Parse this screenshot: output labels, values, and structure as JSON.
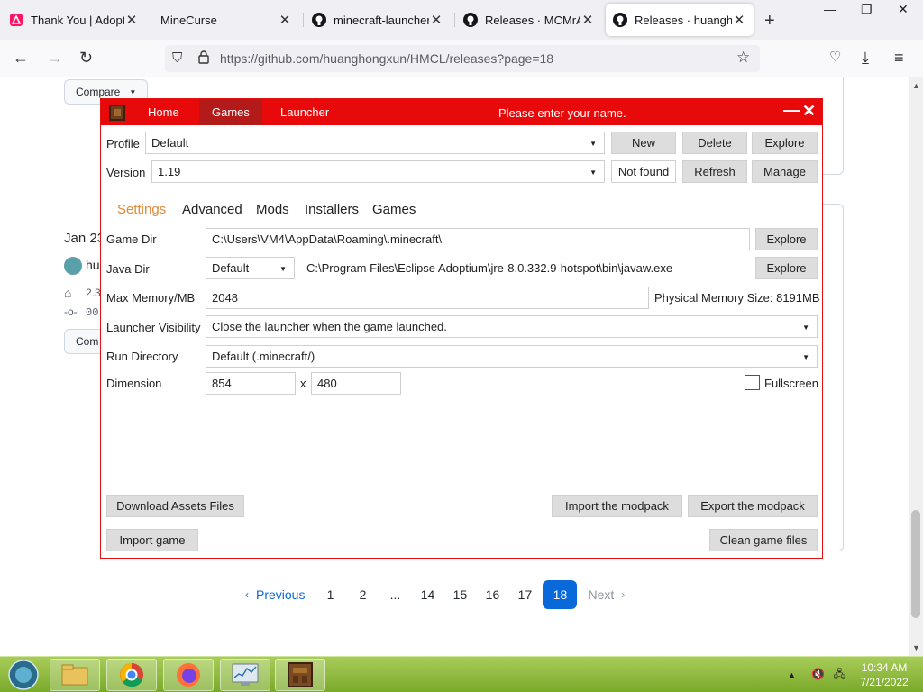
{
  "browser": {
    "tabs": [
      {
        "label": "Thank You | Adoptiu",
        "icon": "adoptium-icon"
      },
      {
        "label": "MineCurse",
        "icon": "none"
      },
      {
        "label": "minecraft-launcher ·",
        "icon": "github-icon"
      },
      {
        "label": "Releases · MCMrARM",
        "icon": "github-icon"
      },
      {
        "label": "Releases · huanghon",
        "icon": "github-icon"
      }
    ],
    "url_prefix": "https://github.com/",
    "url_domain": "github.com",
    "url_full": "https://github.com/huanghongxun/HMCL/releases?page=18"
  },
  "github": {
    "compare_label": "Compare",
    "compare_label_short": "Com",
    "release_date": "Jan 23",
    "author_initials": "hu",
    "tag_text": "2.3",
    "commit_text": "00",
    "pagination": {
      "previous": "Previous",
      "next": "Next",
      "pages": [
        "1",
        "2",
        "...",
        "14",
        "15",
        "16",
        "17",
        "18"
      ],
      "current": "18"
    }
  },
  "hmcl": {
    "nav": {
      "home": "Home",
      "games": "Games",
      "launcher": "Launcher"
    },
    "title_message": "Please enter your name.",
    "profile": {
      "label": "Profile",
      "value": "Default",
      "new": "New",
      "delete": "Delete",
      "explore": "Explore"
    },
    "version": {
      "label": "Version",
      "value": "1.19",
      "status": "Not found",
      "refresh": "Refresh",
      "manage": "Manage"
    },
    "tabs": {
      "settings": "Settings",
      "advanced": "Advanced",
      "mods": "Mods",
      "installers": "Installers",
      "games": "Games"
    },
    "game_dir": {
      "label": "Game Dir",
      "value": "C:\\Users\\VM4\\AppData\\Roaming\\.minecraft\\",
      "explore": "Explore"
    },
    "java_dir": {
      "label": "Java Dir",
      "select": "Default",
      "value": "C:\\Program Files\\Eclipse Adoptium\\jre-8.0.332.9-hotspot\\bin\\javaw.exe",
      "explore": "Explore"
    },
    "memory": {
      "label": "Max Memory/MB",
      "value": "2048",
      "physical": "Physical Memory Size: 8191MB"
    },
    "visibility": {
      "label": "Launcher Visibility",
      "value": "Close the launcher when the game launched."
    },
    "run_dir": {
      "label": "Run Directory",
      "value": "Default (.minecraft/)"
    },
    "dimension": {
      "label": "Dimension",
      "width": "854",
      "separator": "x",
      "height": "480",
      "fullscreen": "Fullscreen"
    },
    "buttons": {
      "download_assets": "Download Assets Files",
      "import_modpack": "Import the modpack",
      "export_modpack": "Export the modpack",
      "import_game": "Import game",
      "clean_game": "Clean game files"
    },
    "colors": {
      "titlebar": "#e80a0a",
      "active_tab": "#e08a3a"
    }
  },
  "taskbar": {
    "time": "10:34 AM",
    "date": "7/21/2022",
    "apps": [
      "start-orb",
      "file-explorer",
      "chrome",
      "firefox",
      "task-manager",
      "minecraft-launcher"
    ]
  }
}
